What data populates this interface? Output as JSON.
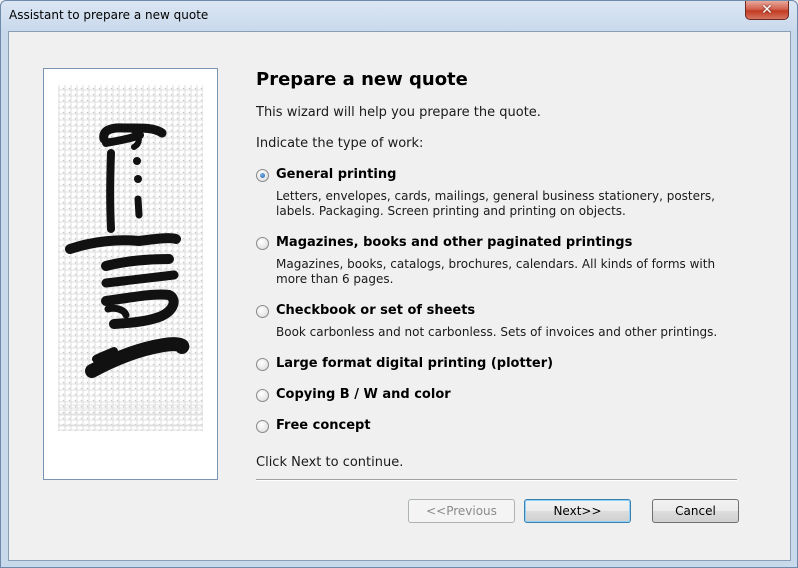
{
  "window": {
    "title": "Assistant to prepare a new quote",
    "close_glyph": "✕"
  },
  "page": {
    "heading": "Prepare a new quote",
    "intro": "This wizard will help you prepare the quote.",
    "prompt": "Indicate the type of work:",
    "footer_hint": "Click Next to continue."
  },
  "options": [
    {
      "label": "General printing",
      "desc": "Letters, envelopes, cards, mailings, general business stationery, posters, labels. Packaging. Screen printing and printing on objects.",
      "checked": true
    },
    {
      "label": "Magazines, books and other paginated printings",
      "desc": "Magazines, books, catalogs, brochures, calendars. All kinds of forms with more than 6 pages.",
      "checked": false
    },
    {
      "label": "Checkbook or set of sheets",
      "desc": "Book carbonless and not carbonless. Sets of invoices and other printings.",
      "checked": false
    },
    {
      "label": "Large format digital printing (plotter)",
      "desc": "",
      "checked": false
    },
    {
      "label": "Copying B / W and color",
      "desc": "",
      "checked": false
    },
    {
      "label": "Free concept",
      "desc": "",
      "checked": false
    }
  ],
  "buttons": {
    "previous": "<<Previous",
    "next": "Next>>",
    "cancel": "Cancel"
  }
}
